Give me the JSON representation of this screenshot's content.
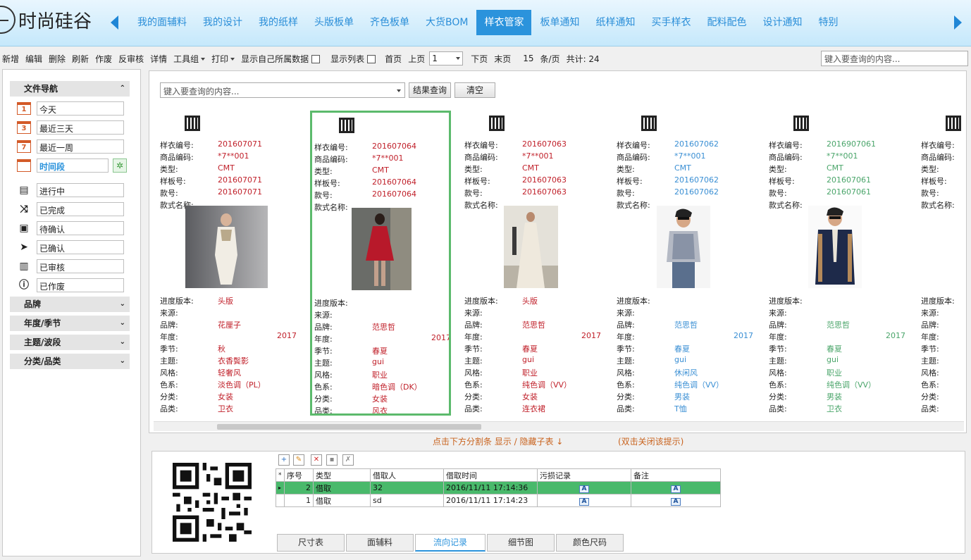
{
  "app": {
    "logo_text": "时尚硅谷"
  },
  "nav_tabs": [
    "我的面辅料",
    "我的设计",
    "我的纸样",
    "头版板单",
    "齐色板单",
    "大货BOM",
    "样衣管家",
    "板单通知",
    "纸样通知",
    "买手样衣",
    "配料配色",
    "设计通知",
    "特别"
  ],
  "active_nav": "样衣管家",
  "toolbar": {
    "items": [
      "新增",
      "编辑",
      "删除",
      "刷新",
      "作废",
      "反审核",
      "详情"
    ],
    "tools_label": "工具组",
    "print_label": "打印",
    "show_own_label": "显示自己所属数据",
    "show_list_label": "显示列表",
    "first_page": "首页",
    "prev_page": "上页",
    "page_value": "1",
    "next_page": "下页",
    "last_page": "末页",
    "per_page": "15",
    "per_page_unit": "条/页",
    "total": "共计: 24",
    "search_placeholder": "键入要查询的内容..."
  },
  "sidebar": {
    "file_nav": "文件导航",
    "dates": [
      "今天",
      "最近三天",
      "最近一周",
      "时间段"
    ],
    "statuses": [
      "进行中",
      "已完成",
      "待确认",
      "已确认",
      "已审核",
      "已作废"
    ],
    "sections": [
      "品牌",
      "年度/季节",
      "主题/波段",
      "分类/品类"
    ]
  },
  "query": {
    "placeholder": "键入要查询的内容...",
    "result_btn": "结果查询",
    "clear_btn": "清空"
  },
  "card_labels": {
    "sample_no": "样衣编号:",
    "product_code": "商品编码:",
    "type": "类型:",
    "pattern_no": "样板号:",
    "style_no": "款号:",
    "style_name": "款式名称:",
    "progress": "进度版本:",
    "source": "来源:",
    "brand": "品牌:",
    "year": "年度:",
    "season": "季节:",
    "theme": "主题:",
    "style": "风格:",
    "color": "色系:",
    "category": "分类:",
    "subcategory": "品类:"
  },
  "cards": [
    {
      "sample_no": "201607071",
      "product_code": "*7**001",
      "type": "CMT",
      "pattern_no": "201607071",
      "style_no": "201607071",
      "progress": "头版",
      "brand": "花厘子",
      "year": "2017",
      "season": "秋",
      "theme": "衣香鬓影",
      "style": "轻奢风",
      "color": "淡色调（PL）",
      "category": "女装",
      "subcategory": "卫衣",
      "color_hex": "#c0202a"
    },
    {
      "sample_no": "201607064",
      "product_code": "*7**001",
      "type": "CMT",
      "pattern_no": "201607064",
      "style_no": "201607064",
      "progress": "",
      "brand": "范思哲",
      "year": "2017",
      "season": "春夏",
      "theme": "gui",
      "style": "职业",
      "color": "暗色调（DK）",
      "category": "女装",
      "subcategory": "风衣",
      "color_hex": "#c0202a"
    },
    {
      "sample_no": "201607063",
      "product_code": "*7**001",
      "type": "CMT",
      "pattern_no": "201607063",
      "style_no": "201607063",
      "progress": "头版",
      "brand": "范思哲",
      "year": "2017",
      "season": "春夏",
      "theme": "gui",
      "style": "职业",
      "color": "纯色调（VV）",
      "category": "女装",
      "subcategory": "连衣裙",
      "color_hex": "#c0202a"
    },
    {
      "sample_no": "201607062",
      "product_code": "*7**001",
      "type": "CMT",
      "pattern_no": "201607062",
      "style_no": "201607062",
      "progress": "",
      "brand": "范思哲",
      "year": "2017",
      "season": "春夏",
      "theme": "gui",
      "style": "休闲风",
      "color": "纯色调（VV）",
      "category": "男装",
      "subcategory": "T恤",
      "color_hex": "#3a8fd4"
    },
    {
      "sample_no": "2016907061",
      "product_code": "*7**001",
      "type": "CMT",
      "pattern_no": "201607061",
      "style_no": "201607061",
      "progress": "",
      "brand": "范思哲",
      "year": "2017",
      "season": "春夏",
      "theme": "gui",
      "style": "职业",
      "color": "纯色调（VV）",
      "category": "男装",
      "subcategory": "卫衣",
      "color_hex": "#4aa56a"
    }
  ],
  "hints": {
    "split": "点击下方分割条  显示 / 隐藏子表 ↓",
    "close": "(双击关闭该提示)"
  },
  "grid": {
    "headers": [
      "序号",
      "类型",
      "借取人",
      "借取时间",
      "污损记录",
      "备注"
    ],
    "rows": [
      {
        "no": "2",
        "type": "借取",
        "person": "32",
        "time": "2016/11/11 17:14:36"
      },
      {
        "no": "1",
        "type": "借取",
        "person": "sd",
        "time": "2016/11/11 17:14:23"
      }
    ]
  },
  "bottom_tabs": [
    "尺寸表",
    "面辅料",
    "流向记录",
    "细节图",
    "颜色尺码"
  ],
  "active_bottom_tab": "流向记录"
}
